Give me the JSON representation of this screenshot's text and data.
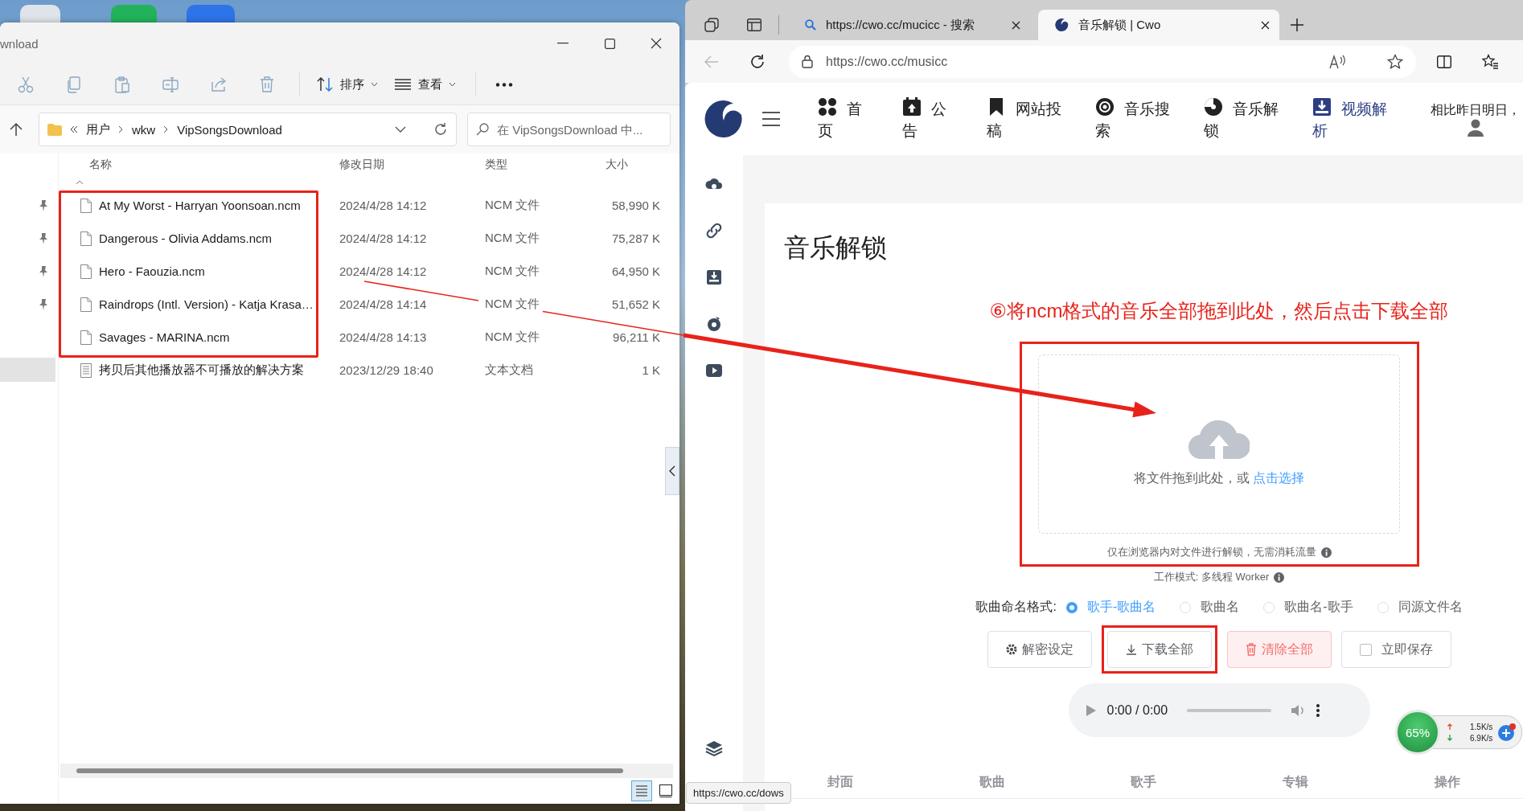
{
  "explorer": {
    "title": "wnload",
    "toolbar": [
      {
        "label": "排序"
      },
      {
        "label": "查看"
      }
    ],
    "path": [
      "用户",
      "wkw",
      "VipSongsDownload"
    ],
    "search": {
      "placeholder": "在 VipSongsDownload 中..."
    },
    "nav_items": [
      {
        "pinned": true,
        "selected": false
      },
      {
        "pinned": true,
        "selected": false
      },
      {
        "pinned": true,
        "selected": false
      },
      {
        "pinned": true,
        "selected": false
      },
      {
        "pinned": false,
        "selected": false
      },
      {
        "pinned": false,
        "selected": true
      }
    ],
    "columns": [
      "名称",
      "修改日期",
      "类型",
      "大小"
    ],
    "rows": [
      {
        "name": "At My Worst - Harryan Yoonsoan.ncm",
        "modified": "2024/4/28 14:12",
        "type": "NCM 文件",
        "size": "58,990 K",
        "kind": "file",
        "highlighted": true
      },
      {
        "name": "Dangerous - Olivia Addams.ncm",
        "modified": "2024/4/28 14:12",
        "type": "NCM 文件",
        "size": "75,287 K",
        "kind": "file",
        "highlighted": true
      },
      {
        "name": "Hero - Faouzia.ncm",
        "modified": "2024/4/28 14:12",
        "type": "NCM 文件",
        "size": "64,950 K",
        "kind": "file",
        "highlighted": true
      },
      {
        "name": "Raindrops (Intl. Version) - Katja Krasa…",
        "modified": "2024/4/28 14:14",
        "type": "NCM 文件",
        "size": "51,652 K",
        "kind": "file",
        "highlighted": true
      },
      {
        "name": "Savages - MARINA.ncm",
        "modified": "2024/4/28 14:13",
        "type": "NCM 文件",
        "size": "96,211 K",
        "kind": "file",
        "highlighted": true
      },
      {
        "name": "拷贝后其他播放器不可播放的解决方案",
        "modified": "2023/12/29 18:40",
        "type": "文本文档",
        "size": "1 K",
        "kind": "text",
        "highlighted": false
      }
    ],
    "view_modes": [
      {
        "kind": "details",
        "selected": true
      },
      {
        "kind": "tiles",
        "selected": false
      }
    ]
  },
  "browser": {
    "tabs": [
      {
        "title": "https://cwo.cc/mucicc - 搜索",
        "selected": false
      },
      {
        "title": "音乐解锁 | Cwo",
        "selected": true
      }
    ],
    "back_disabled": true,
    "url": "https://cwo.cc/musicc",
    "nav": [
      {
        "label": "首页",
        "selected": false
      },
      {
        "label": "公告",
        "selected": false
      },
      {
        "label": "网站投稿",
        "selected": false
      },
      {
        "label": "音乐搜索",
        "selected": false
      },
      {
        "label": "音乐解锁",
        "selected": false
      },
      {
        "label": "视频解析",
        "selected": true
      }
    ],
    "greeting": "相比昨日明日，",
    "page": {
      "title": "音乐解锁",
      "annotation": "⑥将ncm格式的音乐全部拖到此处，然后点击下载全部",
      "upload": {
        "text": "将文件拖到此处，或",
        "link": "点击选择",
        "highlighted": true
      },
      "notes": [
        "仅在浏览器内对文件进行解锁，无需消耗流量",
        "工作模式: 多线程 Worker"
      ],
      "naming": {
        "label": "歌曲命名格式:",
        "options": [
          {
            "label": "歌手-歌曲名",
            "selected": true
          },
          {
            "label": "歌曲名",
            "selected": false
          },
          {
            "label": "歌曲名-歌手",
            "selected": false
          },
          {
            "label": "同源文件名",
            "selected": false
          }
        ]
      },
      "buttons": [
        {
          "label": "解密设定",
          "kind": "settings",
          "highlighted": false
        },
        {
          "label": "下载全部",
          "kind": "download",
          "highlighted": true
        },
        {
          "label": "清除全部",
          "kind": "danger",
          "highlighted": false
        },
        {
          "label": "立即保存",
          "kind": "checkbox",
          "checked": false,
          "highlighted": false
        }
      ],
      "player": {
        "time": "0:00 / 0:00",
        "level": 0
      },
      "table_columns": [
        "封面",
        "歌曲",
        "歌手",
        "专辑",
        "操作"
      ]
    },
    "status_url": "https://cwo.cc/dows"
  },
  "net_monitor": {
    "percent": "65%",
    "up": "1.5K/s",
    "down": "6.9K/s"
  }
}
